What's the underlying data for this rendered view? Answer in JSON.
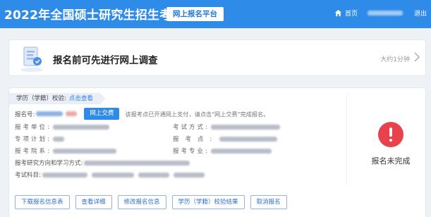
{
  "header": {
    "title": "2022年全国硕士研究生招生考试",
    "platform": "网上报名平台",
    "home": "首页",
    "logout": "退出"
  },
  "survey": {
    "title": "报名前可先进行网上调查",
    "time": "大约1分钟"
  },
  "registration": {
    "verify_label": "学历（学籍）校验:",
    "verify_link": "点击查看",
    "reg_no_label": "报名号:",
    "pay_button": "网上交费",
    "pay_note": "该报考点已开通网上支付，请点击\"网上交费\"完成报名。",
    "unit_label": "报考单位:",
    "exam_mode_label": "考试方式:",
    "plan_label": "专项计划:",
    "site_label": "报考点:",
    "dept_label": "报考院系:",
    "major_label": "报考专业:",
    "direction_label": "报考研究方向和学习方式:",
    "subjects_label": "考试科目:",
    "status": "报名未完成"
  },
  "actions": [
    "下载报名信息表",
    "查看详细",
    "修改报名信息",
    "学历（学籍）校验结果",
    "取消报名"
  ],
  "colors": {
    "header_bg": "#2f8be8",
    "primary": "#2f8be8",
    "status_error": "#e8434d"
  }
}
